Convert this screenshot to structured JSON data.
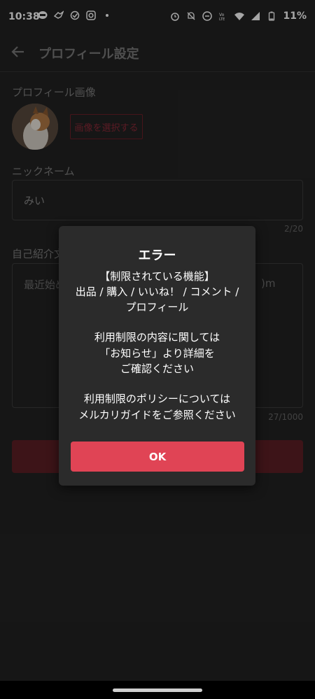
{
  "status_bar": {
    "time": "10:38",
    "battery_percent": "11%"
  },
  "header": {
    "title": "プロフィール設定"
  },
  "profile_image": {
    "label": "プロフィール画像",
    "select_button": "画像を選択する"
  },
  "nickname": {
    "label": "ニックネーム",
    "value": "みい",
    "counter": "2/20"
  },
  "bio": {
    "label": "自己紹介文",
    "value_left": "最近始め",
    "value_right": ")m",
    "counter": "27/1000"
  },
  "dialog": {
    "title": "エラー",
    "restricted_heading": "【制限されている機能】",
    "restricted_line1": "出品 / 購入 / いいね！ / コメント /",
    "restricted_line2": "プロフィール",
    "info_line1": "利用制限の内容に関しては",
    "info_line2": "「お知らせ」より詳細を",
    "info_line3": "ご確認ください",
    "policy_line1": "利用制限のポリシーについては",
    "policy_line2": "メルカリガイドをご参照ください",
    "ok_button": "OK"
  },
  "colors": {
    "accent": "#e04455",
    "background": "#232323",
    "dialog_background": "#2b2b2b"
  }
}
